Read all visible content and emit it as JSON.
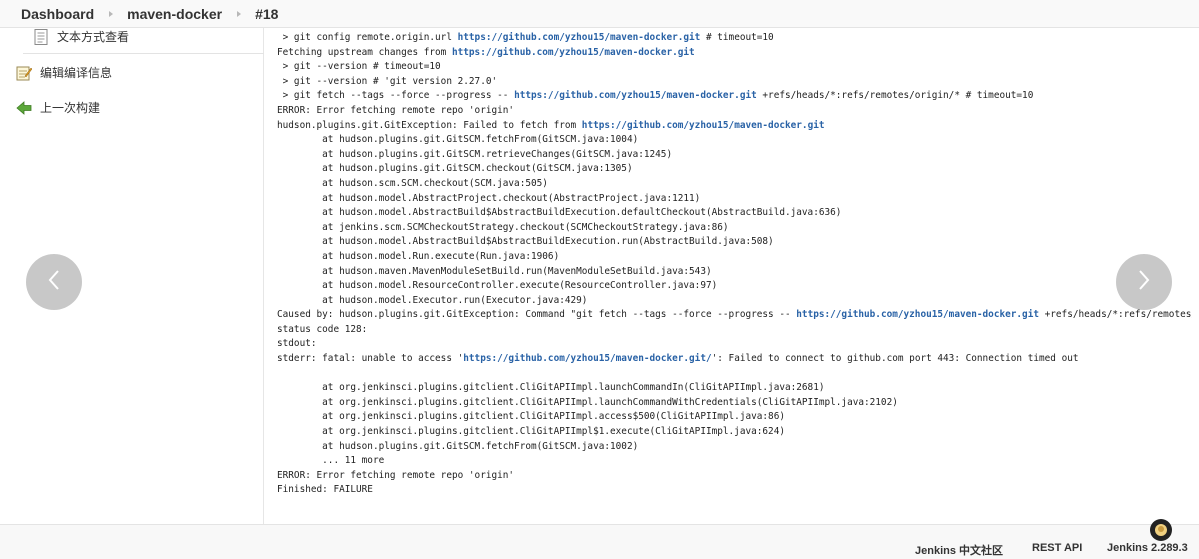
{
  "breadcrumb": {
    "items": [
      "Dashboard",
      "maven-docker",
      "#18"
    ]
  },
  "sidebar": {
    "items": [
      {
        "label": "文本方式查看",
        "icon": "document-icon"
      },
      {
        "label": "编辑编译信息",
        "icon": "edit-notepad-icon"
      },
      {
        "label": "上一次构建",
        "icon": "arrow-left-icon"
      }
    ]
  },
  "console": {
    "lines": [
      [
        {
          "t": " > git config remote.origin.url "
        },
        {
          "l": "https://github.com/yzhou15/maven-docker.git"
        },
        {
          "t": " # timeout=10"
        }
      ],
      [
        {
          "t": "Fetching upstream changes from "
        },
        {
          "l": "https://github.com/yzhou15/maven-docker.git"
        }
      ],
      [
        {
          "t": " > git --version # timeout=10"
        }
      ],
      [
        {
          "t": " > git --version # 'git version 2.27.0'"
        }
      ],
      [
        {
          "t": " > git fetch --tags --force --progress -- "
        },
        {
          "l": "https://github.com/yzhou15/maven-docker.git"
        },
        {
          "t": " +refs/heads/*:refs/remotes/origin/* # timeout=10"
        }
      ],
      [
        {
          "t": "ERROR: Error fetching remote repo 'origin'"
        }
      ],
      [
        {
          "t": "hudson.plugins.git.GitException: Failed to fetch from "
        },
        {
          "l": "https://github.com/yzhou15/maven-docker.git"
        }
      ],
      [
        {
          "t": "\tat hudson.plugins.git.GitSCM.fetchFrom(GitSCM.java:1004)"
        }
      ],
      [
        {
          "t": "\tat hudson.plugins.git.GitSCM.retrieveChanges(GitSCM.java:1245)"
        }
      ],
      [
        {
          "t": "\tat hudson.plugins.git.GitSCM.checkout(GitSCM.java:1305)"
        }
      ],
      [
        {
          "t": "\tat hudson.scm.SCM.checkout(SCM.java:505)"
        }
      ],
      [
        {
          "t": "\tat hudson.model.AbstractProject.checkout(AbstractProject.java:1211)"
        }
      ],
      [
        {
          "t": "\tat hudson.model.AbstractBuild$AbstractBuildExecution.defaultCheckout(AbstractBuild.java:636)"
        }
      ],
      [
        {
          "t": "\tat jenkins.scm.SCMCheckoutStrategy.checkout(SCMCheckoutStrategy.java:86)"
        }
      ],
      [
        {
          "t": "\tat hudson.model.AbstractBuild$AbstractBuildExecution.run(AbstractBuild.java:508)"
        }
      ],
      [
        {
          "t": "\tat hudson.model.Run.execute(Run.java:1906)"
        }
      ],
      [
        {
          "t": "\tat hudson.maven.MavenModuleSetBuild.run(MavenModuleSetBuild.java:543)"
        }
      ],
      [
        {
          "t": "\tat hudson.model.ResourceController.execute(ResourceController.java:97)"
        }
      ],
      [
        {
          "t": "\tat hudson.model.Executor.run(Executor.java:429)"
        }
      ],
      [
        {
          "t": "Caused by: hudson.plugins.git.GitException: Command \"git fetch --tags --force --progress -- "
        },
        {
          "l": "https://github.com/yzhou15/maven-docker.git"
        },
        {
          "t": " +refs/heads/*:refs/remotes/origin/*\" returned"
        }
      ],
      [
        {
          "t": "status code 128:"
        }
      ],
      [
        {
          "t": "stdout:"
        }
      ],
      [
        {
          "t": "stderr: fatal: unable to access '"
        },
        {
          "l": "https://github.com/yzhou15/maven-docker.git/"
        },
        {
          "t": "': Failed to connect to github.com port 443: Connection timed out"
        }
      ],
      [
        {
          "t": ""
        }
      ],
      [
        {
          "t": "\tat org.jenkinsci.plugins.gitclient.CliGitAPIImpl.launchCommandIn(CliGitAPIImpl.java:2681)"
        }
      ],
      [
        {
          "t": "\tat org.jenkinsci.plugins.gitclient.CliGitAPIImpl.launchCommandWithCredentials(CliGitAPIImpl.java:2102)"
        }
      ],
      [
        {
          "t": "\tat org.jenkinsci.plugins.gitclient.CliGitAPIImpl.access$500(CliGitAPIImpl.java:86)"
        }
      ],
      [
        {
          "t": "\tat org.jenkinsci.plugins.gitclient.CliGitAPIImpl$1.execute(CliGitAPIImpl.java:624)"
        }
      ],
      [
        {
          "t": "\tat hudson.plugins.git.GitSCM.fetchFrom(GitSCM.java:1002)"
        }
      ],
      [
        {
          "t": "\t... 11 more"
        }
      ],
      [
        {
          "t": "ERROR: Error fetching remote repo 'origin'"
        }
      ],
      [
        {
          "t": "Finished: FAILURE"
        }
      ]
    ]
  },
  "nav": {
    "prev_icon": "chevron-left-icon",
    "next_icon": "chevron-right-icon"
  },
  "footer": {
    "community": "Jenkins 中文社区",
    "rest_api": "REST API",
    "version": "Jenkins 2.289.3"
  },
  "colors": {
    "link": "#2962a6",
    "nav_button": "#bebebe",
    "footer_bg": "#f8f8f8"
  }
}
